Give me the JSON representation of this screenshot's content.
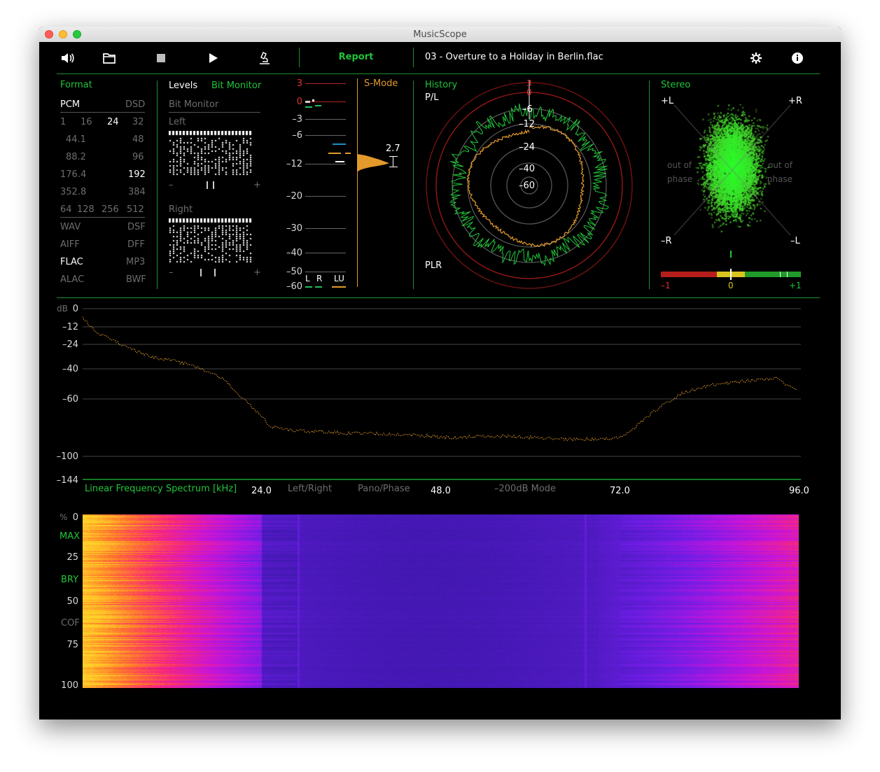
{
  "window": {
    "title": "MusicScope"
  },
  "toolbar": {
    "icons": [
      "speaker-icon",
      "folder-icon",
      "stop-icon",
      "play-icon",
      "microscope-icon",
      "gear-icon",
      "info-icon"
    ],
    "report_label": "Report",
    "file_name": "03 - Overture to a Holiday in Berlin.flac"
  },
  "format": {
    "title": "Format",
    "pcm": "PCM",
    "dsd": "DSD",
    "bits": [
      "1",
      "16",
      "24",
      "32"
    ],
    "rates_row1": [
      "44.1",
      "48"
    ],
    "rates_row2": [
      "88.2",
      "96"
    ],
    "rates_row3": [
      "176.4",
      "192"
    ],
    "rates_row4": [
      "352.8",
      "384"
    ],
    "dsd_rates": [
      "64",
      "128",
      "256",
      "512"
    ],
    "types": [
      [
        "WAV",
        "DSF"
      ],
      [
        "AIFF",
        "DFF"
      ],
      [
        "FLAC",
        "MP3"
      ],
      [
        "ALAC",
        "BWF"
      ]
    ]
  },
  "levels": {
    "tab_levels": "Levels",
    "tab_bit_monitor": "Bit Monitor",
    "heading": "Bit Monitor",
    "left_label": "Left",
    "right_label": "Right",
    "minus": "–",
    "plus": "+"
  },
  "meter": {
    "scale": [
      "3",
      "0",
      "–3",
      "–6",
      "–12",
      "–20",
      "–30",
      "–40",
      "–50",
      "–60"
    ],
    "smode": "S-Mode",
    "value": "2.7",
    "channels": [
      "L",
      "R",
      "LU"
    ]
  },
  "history": {
    "title": "History",
    "pl": "P/L",
    "plr": "PLR",
    "ring_labels": [
      "3",
      "0",
      "–6",
      "–12",
      "–24",
      "–40",
      "–60"
    ]
  },
  "stereo": {
    "title": "Stereo",
    "corners": [
      "+L",
      "+R",
      "–R",
      "–L"
    ],
    "out_of_phase": [
      "out of",
      "phase"
    ],
    "bar_labels": [
      "–1",
      "0",
      "+1"
    ],
    "correlation": 0.0
  },
  "spectrum": {
    "db_label": "dB",
    "y_ticks": [
      "0",
      "–12",
      "–24",
      "–40",
      "–60",
      "–100",
      "–144"
    ],
    "x_ticks": [
      "24.0",
      "48.0",
      "72.0",
      "96.0"
    ],
    "mode_label": "Linear Frequency Spectrum [kHz]",
    "options": [
      "Left/Right",
      "Pano/Phase",
      "–200dB Mode"
    ]
  },
  "spectrogram": {
    "pct_label": "%",
    "y_ticks": [
      "0",
      "25",
      "50",
      "75",
      "100"
    ],
    "markers": [
      "MAX",
      "BRY",
      "COF"
    ]
  },
  "colors": {
    "accent_green": "#21c43a",
    "peak_red": "#e3322e",
    "curve_orange": "#e39a2b"
  }
}
